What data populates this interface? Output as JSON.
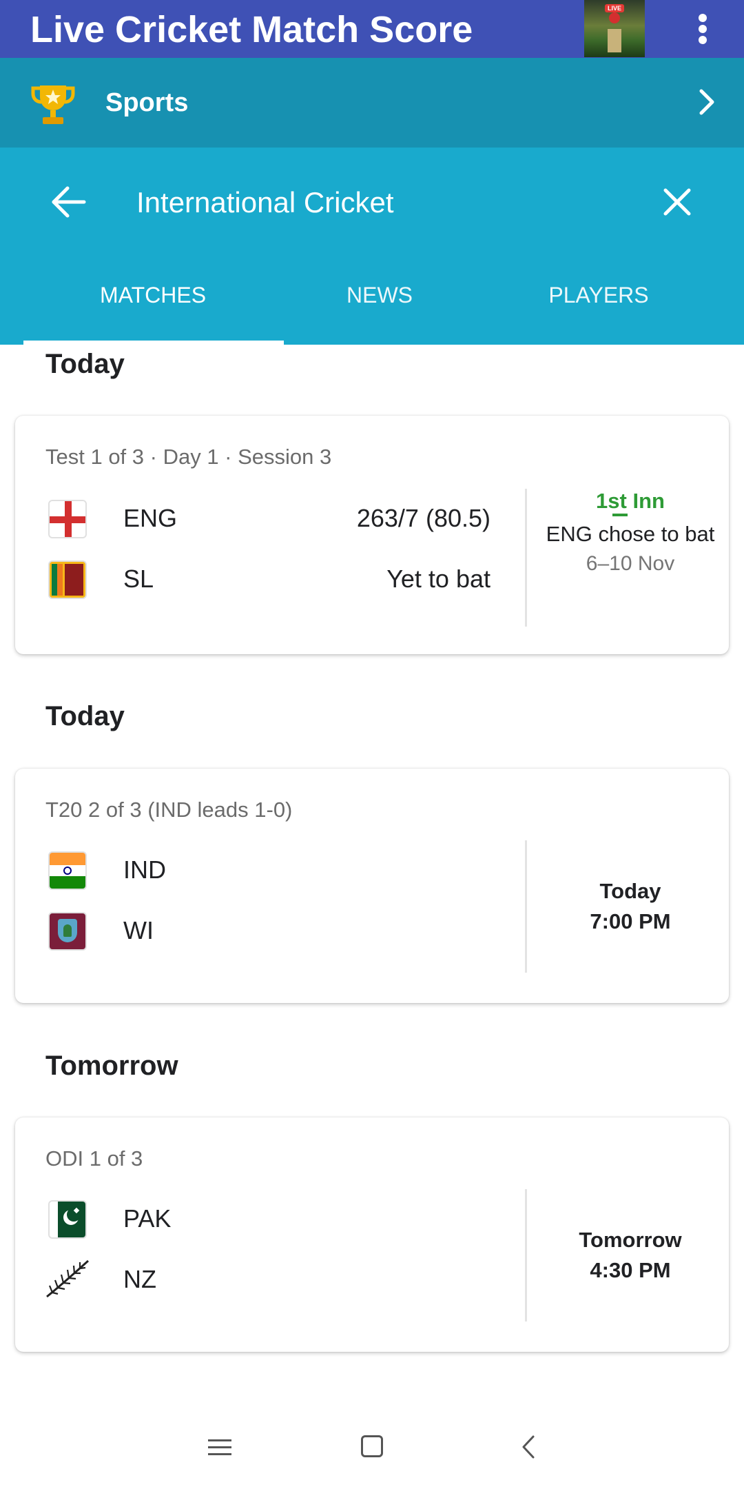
{
  "app": {
    "title": "Live Cricket Match Score",
    "thumbnail_badge": "LIVE"
  },
  "sports_bar": {
    "label": "Sports"
  },
  "header": {
    "title": "International Cricket"
  },
  "tabs": [
    {
      "label": "MATCHES",
      "selected": true
    },
    {
      "label": "NEWS",
      "selected": false
    },
    {
      "label": "PLAYERS",
      "selected": false
    }
  ],
  "sections": [
    {
      "title": "Today",
      "match": {
        "subtitle": "Test 1 of 3 · Day 1 · Session 3",
        "teams": [
          {
            "code": "ENG",
            "score": "263/7 (80.5)",
            "flag": "england-flag-icon"
          },
          {
            "code": "SL",
            "score": "Yet to bat",
            "flag": "sri-lanka-flag-icon"
          }
        ],
        "status": {
          "innings": "1st Inn",
          "decision": "ENG chose to bat",
          "dates": "6–10 Nov"
        }
      }
    },
    {
      "title": "Today",
      "match": {
        "subtitle": "T20 2 of 3 (IND leads 1-0)",
        "teams": [
          {
            "code": "IND",
            "flag": "india-flag-icon"
          },
          {
            "code": "WI",
            "flag": "west-indies-flag-icon"
          }
        ],
        "status": {
          "day": "Today",
          "time": "7:00 PM"
        }
      }
    },
    {
      "title": "Tomorrow",
      "match": {
        "subtitle": "ODI 1 of 3",
        "teams": [
          {
            "code": "PAK",
            "flag": "pakistan-flag-icon"
          },
          {
            "code": "NZ",
            "flag": "new-zealand-fern-icon"
          }
        ],
        "status": {
          "day": "Tomorrow",
          "time": "4:30 PM"
        }
      }
    }
  ],
  "colors": {
    "app_bar": "#3f51b5",
    "sports_bar": "#1791b1",
    "header": "#19aacd",
    "innings_green": "#2e9b36"
  },
  "icons": {
    "overflow": "more-vert-icon",
    "trophy": "trophy-icon",
    "chevron": "chevron-right-icon",
    "back": "arrow-back-icon",
    "close": "close-icon",
    "nav_menu": "nav-menu-icon",
    "nav_home": "nav-home-icon",
    "nav_back": "nav-back-icon"
  }
}
